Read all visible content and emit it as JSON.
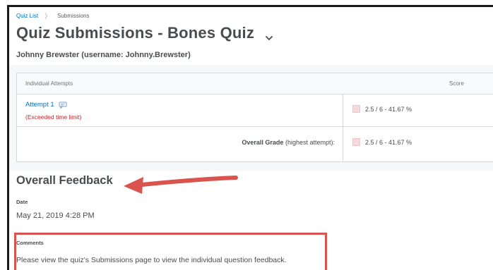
{
  "breadcrumb": {
    "quiz_list": "Quiz List",
    "separator": "〉",
    "current": "Submissions"
  },
  "page": {
    "title": "Quiz Submissions - Bones Quiz",
    "user_line": "Johnny Brewster (username: Johnny.Brewster)"
  },
  "attempts_table": {
    "header_left": "Individual Attempts",
    "header_right": "Score",
    "attempt": {
      "label": "Attempt 1",
      "warning": "(Exceeded time limit)",
      "score": "2.5 / 6 - 41.67 %"
    },
    "overall": {
      "label_bold": "Overall Grade",
      "label_rest": "(highest attempt):",
      "score": "2.5 / 6 - 41.67 %"
    }
  },
  "feedback": {
    "heading": "Overall Feedback",
    "date_label": "Date",
    "date_value": "May 21, 2019 4:28 PM",
    "comments_label": "Comments",
    "comments_text": "Please view the quiz's Submissions page to view the individual question feedback."
  },
  "colors": {
    "link": "#006fbf",
    "warning": "#cd2026",
    "annotation": "#d9534f",
    "score_indicator": "#f7d9dc"
  },
  "icons": {
    "title_menu": "chevron-down-icon",
    "attempt_comment": "comment-icon",
    "annotation_arrow": "arrow-left-icon"
  }
}
